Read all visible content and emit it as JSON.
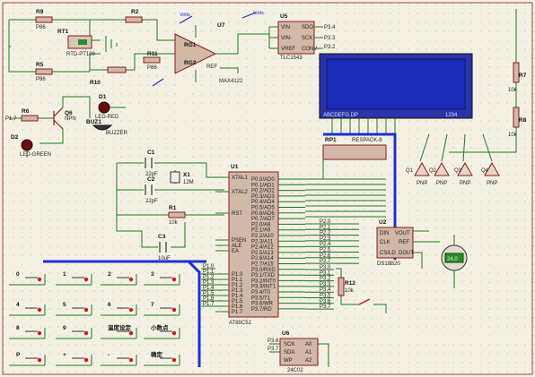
{
  "components": {
    "R9": "R9",
    "R9_val": "P86",
    "R2": "R2",
    "RT1": "RT1",
    "RT1_part": "RTD-PT100",
    "R5": "R5",
    "R5_val": "P86",
    "R10": "R10",
    "R11": "R11",
    "R11_val": "P86",
    "U7": "U7",
    "U7_part": "MAX4122",
    "U5": "U5",
    "U5_part": "TLC1543",
    "U5_pins": [
      "VIN",
      "SDO",
      "VIN-",
      "SCK",
      "VREF",
      "CONV"
    ],
    "U5_nets": [
      "P3.4",
      "P3.3",
      "P3.2"
    ],
    "probe_a": "Volts",
    "probe_b": "Volts",
    "Q6": "Q6",
    "Q6_part": "NPN",
    "D1": "D1",
    "D1_part": "LED-RED",
    "R6": "R6",
    "R6_net": "P1.7",
    "BUZ1": "BUZ1",
    "BUZ1_part": "BUZZER",
    "D2": "D2",
    "D2_part": "LED-GREEN",
    "lcd_label_left": "ABCDEFG  DP",
    "lcd_label_right": "1234",
    "R7": "R7",
    "R8": "R8",
    "R7_val": "10k",
    "R8_val": "10k",
    "C1": "C1",
    "C1_val": "22pF",
    "C2": "C2",
    "C2_val": "22pF",
    "X1": "X1",
    "X1_val": "12M",
    "R1": "R1",
    "R1_val": "10k",
    "C3": "C3",
    "C3_val": "10uF",
    "U1": "U1",
    "U1_part": "AT89C52",
    "RP1": "RP1",
    "RP1_part": "RESPACK-8",
    "U2": "U2",
    "U2_part": "DS18B20",
    "U2_temp": "24.0",
    "R12": "R12",
    "R12_val": "10k",
    "U6": "U6",
    "U6_part": "24C02",
    "U6_pins": [
      "SCK",
      "SDA",
      "WP",
      "A0",
      "A1",
      "A2"
    ],
    "U6_nets": [
      "P3.6",
      "P3.7"
    ],
    "transistors": [
      "Q1",
      "Q2",
      "Q3",
      "Q4"
    ],
    "transistor_part": "PNP"
  },
  "u1_left_pins": [
    "XTAL1",
    "XTAL2",
    "RST",
    "PSEN",
    "ALE",
    "EA",
    "P1.0",
    "P1.1",
    "P1.2",
    "P1.3",
    "P1.4",
    "P1.5",
    "P1.6",
    "P1.7"
  ],
  "u1_right_pins": [
    "P0.0/AD0",
    "P0.1/AD1",
    "P0.2/AD2",
    "P0.3/AD3",
    "P0.4/AD4",
    "P0.5/AD5",
    "P0.6/AD6",
    "P0.7/AD7",
    "P2.0/A8",
    "P2.1/A9",
    "P2.2/A10",
    "P2.3/A11",
    "P2.4/A12",
    "P2.5/A13",
    "P2.6/A14",
    "P2.7/A15",
    "P3.0/RXD",
    "P3.1/TXD",
    "P3.2/INT0",
    "P3.3/INT1",
    "P3.4/T0",
    "P3.5/T1",
    "P3.6/WR",
    "P3.7/RD"
  ],
  "u1_p2_nets": [
    "P2.0",
    "P2.1",
    "P2.2",
    "P2.3",
    "P2.4",
    "P2.5",
    "P2.6",
    "P2.7"
  ],
  "u1_p3_nets": [
    "P3.0",
    "P3.1",
    "P3.2",
    "P3.3",
    "P3.4",
    "P3.5",
    "P3.6",
    "P3.7"
  ],
  "keypad_labels": [
    "0",
    "1",
    "2",
    "3",
    "4",
    "5",
    "6",
    "7",
    "8",
    "9",
    "温度设定",
    "小数点",
    "P",
    "+",
    "-",
    "确定"
  ],
  "keypad_nets": [
    "P1.0",
    "P1.1",
    "P1.2",
    "P1.3",
    "P1.4",
    "P1.5",
    "P1.6",
    "P1.7"
  ],
  "colors": {
    "wire": "#1a7a1a",
    "bus": "#1f2fd0",
    "body": "#d2b8a6",
    "lcd": "#1a2bb8",
    "switch": "#cc1a1a",
    "background": "#f4f1e4"
  }
}
